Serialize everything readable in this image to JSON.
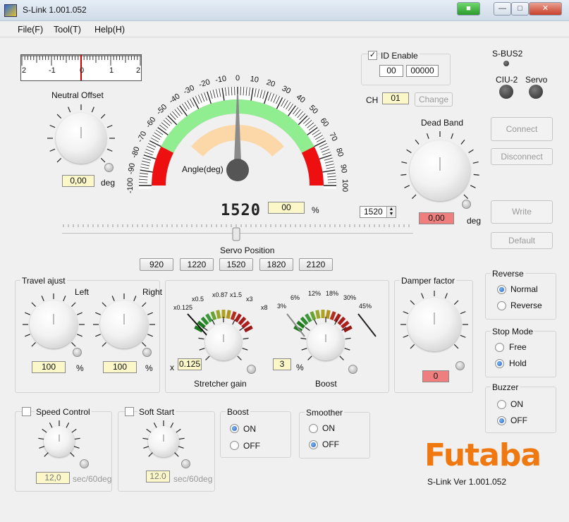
{
  "window": {
    "title": "S-Link 1.001.052"
  },
  "menu": {
    "file": "File(F)",
    "tool": "Tool(T)",
    "help": "Help(H)"
  },
  "neutral": {
    "scale_labels": [
      "2",
      "-1",
      "0",
      "1",
      "2"
    ],
    "title": "Neutral Offset",
    "value": "0,00",
    "unit": "deg"
  },
  "gauge": {
    "ticks": [
      "-100",
      "-90",
      "-80",
      "-70",
      "-60",
      "-50",
      "-40",
      "-30",
      "-20",
      "-10",
      "0",
      "10",
      "20",
      "30",
      "40",
      "50",
      "60",
      "70",
      "80",
      "90",
      "100"
    ],
    "label": "Angle(deg)",
    "digital": "1520",
    "percent_value": "00",
    "percent_unit": "%"
  },
  "spin": {
    "value": "1520"
  },
  "servo_position": {
    "label": "Servo Position",
    "value": 0.5,
    "presets": [
      "920",
      "1220",
      "1520",
      "1820",
      "2120"
    ]
  },
  "id": {
    "enable_label": "ID Enable",
    "checked": "✓",
    "id1": "00",
    "id2": "00000",
    "ch_label": "CH",
    "ch_value": "01",
    "change_label": "Change"
  },
  "sbus": {
    "sbus2": "S-BUS2",
    "ciu2": "CIU-2",
    "servo": "Servo"
  },
  "buttons": {
    "connect": "Connect",
    "disconnect": "Disconnect",
    "write": "Write",
    "default": "Default"
  },
  "deadband": {
    "title": "Dead Band",
    "value": "0,00",
    "unit": "deg"
  },
  "travel": {
    "title": "Travel ajust",
    "left": "Left",
    "right": "Right",
    "left_value": "100",
    "right_value": "100",
    "unit": "%"
  },
  "stretcher": {
    "scale": [
      "x0.125",
      "x0.5",
      "x0.87",
      "x1.5",
      "x3",
      "x8"
    ],
    "prefix": "x",
    "value": "0.125",
    "label": "Stretcher gain"
  },
  "boost_gauge": {
    "scale": [
      "3%",
      "6%",
      "12%",
      "18%",
      "30%",
      "45%"
    ],
    "value": "3",
    "unit": "%",
    "label": "Boost"
  },
  "damper": {
    "title": "Damper factor",
    "value": "0"
  },
  "reverse": {
    "title": "Reverse",
    "normal": "Normal",
    "reverse": "Reverse"
  },
  "stopmode": {
    "title": "Stop Mode",
    "free": "Free",
    "hold": "Hold"
  },
  "buzzer": {
    "title": "Buzzer",
    "on": "ON",
    "off": "OFF"
  },
  "speed": {
    "title": "Speed Control",
    "value": "12,0",
    "unit": "sec/60deg"
  },
  "softstart": {
    "title": "Soft Start",
    "value": "12.0",
    "unit": "sec/60deg"
  },
  "boost": {
    "title": "Boost",
    "on": "ON",
    "off": "OFF"
  },
  "smoother": {
    "title": "Smoother",
    "on": "ON",
    "off": "OFF"
  },
  "brand": {
    "logo": "Futaba",
    "version": "S-Link  Ver 1.001.052",
    "color": "#f07810"
  }
}
